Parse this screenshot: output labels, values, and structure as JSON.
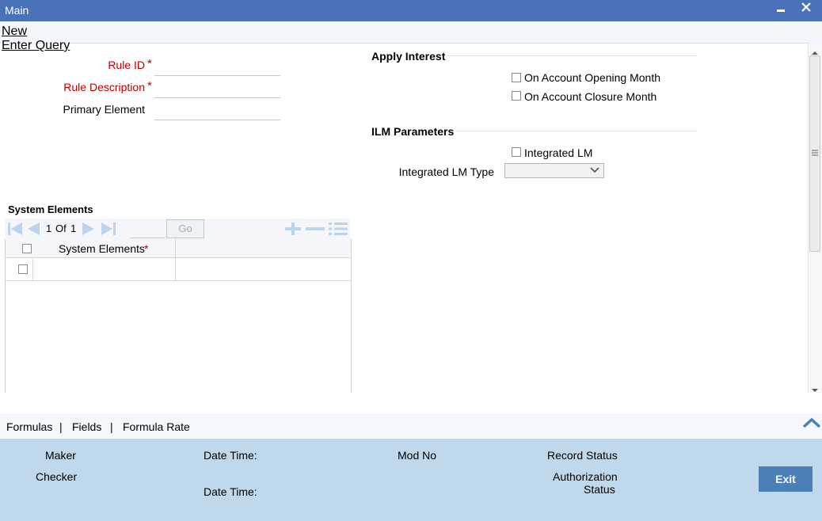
{
  "window": {
    "title": "Main",
    "minimize": "▬",
    "close": "✕"
  },
  "menu": {
    "new": "New",
    "enter_query": "Enter Query"
  },
  "form": {
    "rule_id_label": "Rule ID",
    "rule_description_label": "Rule Description",
    "primary_element_label": "Primary Element",
    "required_marker": "*",
    "rule_id_value": "",
    "rule_description_value": "",
    "primary_element_value": ""
  },
  "apply_interest": {
    "title": "Apply Interest",
    "on_account_opening_month": {
      "label": "On Account Opening Month",
      "checked": false
    },
    "on_account_closure_month": {
      "label": "On Account Closure Month",
      "checked": false
    }
  },
  "ilm": {
    "title": "ILM Parameters",
    "integrated_lm": {
      "label": "Integrated LM",
      "checked": false
    },
    "integrated_lm_type_label": "Integrated LM Type",
    "integrated_lm_type_value": ""
  },
  "system_elements": {
    "title": "System Elements",
    "pager": {
      "current": "1",
      "of_label": "Of",
      "total": "1",
      "go_label": "Go",
      "page_input": ""
    },
    "column_header": "System Elements",
    "required_marker": "*",
    "rows": [
      {
        "value": "",
        "checked": false
      }
    ]
  },
  "tabs": {
    "formulas": "Formulas",
    "fields": "Fields",
    "formula_rate": "Formula Rate",
    "separator": "|"
  },
  "audit": {
    "maker": "Maker",
    "checker": "Checker",
    "date_time_1": "Date Time:",
    "date_time_2": "Date Time:",
    "mod_no": "Mod No",
    "record_status": "Record Status",
    "authorization": "Authorization",
    "status": "Status",
    "exit": "Exit"
  },
  "colors": {
    "title_bar": "#4a72b8",
    "required": "#c00000",
    "footer": "#bfd8ec",
    "exit_button": "#4a7fb8"
  }
}
